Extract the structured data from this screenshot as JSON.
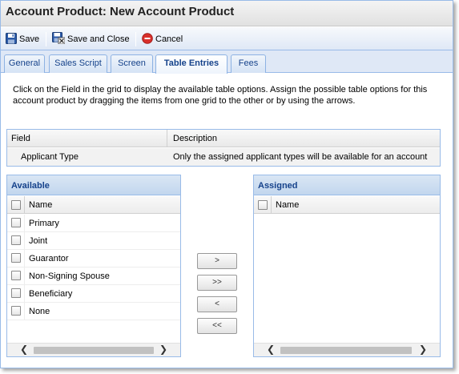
{
  "window": {
    "title": "Account Product: New Account Product"
  },
  "toolbar": {
    "save_label": "Save",
    "save_close_label": "Save and Close",
    "cancel_label": "Cancel"
  },
  "tabs": [
    {
      "label": "General"
    },
    {
      "label": "Sales Script"
    },
    {
      "label": "Screen"
    },
    {
      "label": "Table Entries",
      "active": true
    },
    {
      "label": "Fees"
    }
  ],
  "instructions": "Click on the Field in the grid to display the available table options. Assign the possible table options for this account product by dragging the items from one grid to the other or by using the arrows.",
  "field_grid": {
    "headers": {
      "field": "Field",
      "description": "Description"
    },
    "rows": [
      {
        "field": "Applicant Type",
        "description": "Only the assigned applicant types will be available for an account"
      }
    ]
  },
  "available": {
    "title": "Available",
    "column": "Name",
    "items": [
      "Primary",
      "Joint",
      "Guarantor",
      "Non-Signing Spouse",
      "Beneficiary",
      "None"
    ]
  },
  "assigned": {
    "title": "Assigned",
    "column": "Name",
    "items": []
  },
  "move_buttons": {
    "add": ">",
    "add_all": ">>",
    "remove": "<",
    "remove_all": "<<"
  },
  "colors": {
    "accent": "#15428b",
    "border": "#99bbe8",
    "cancel_icon": "#d9302b"
  }
}
